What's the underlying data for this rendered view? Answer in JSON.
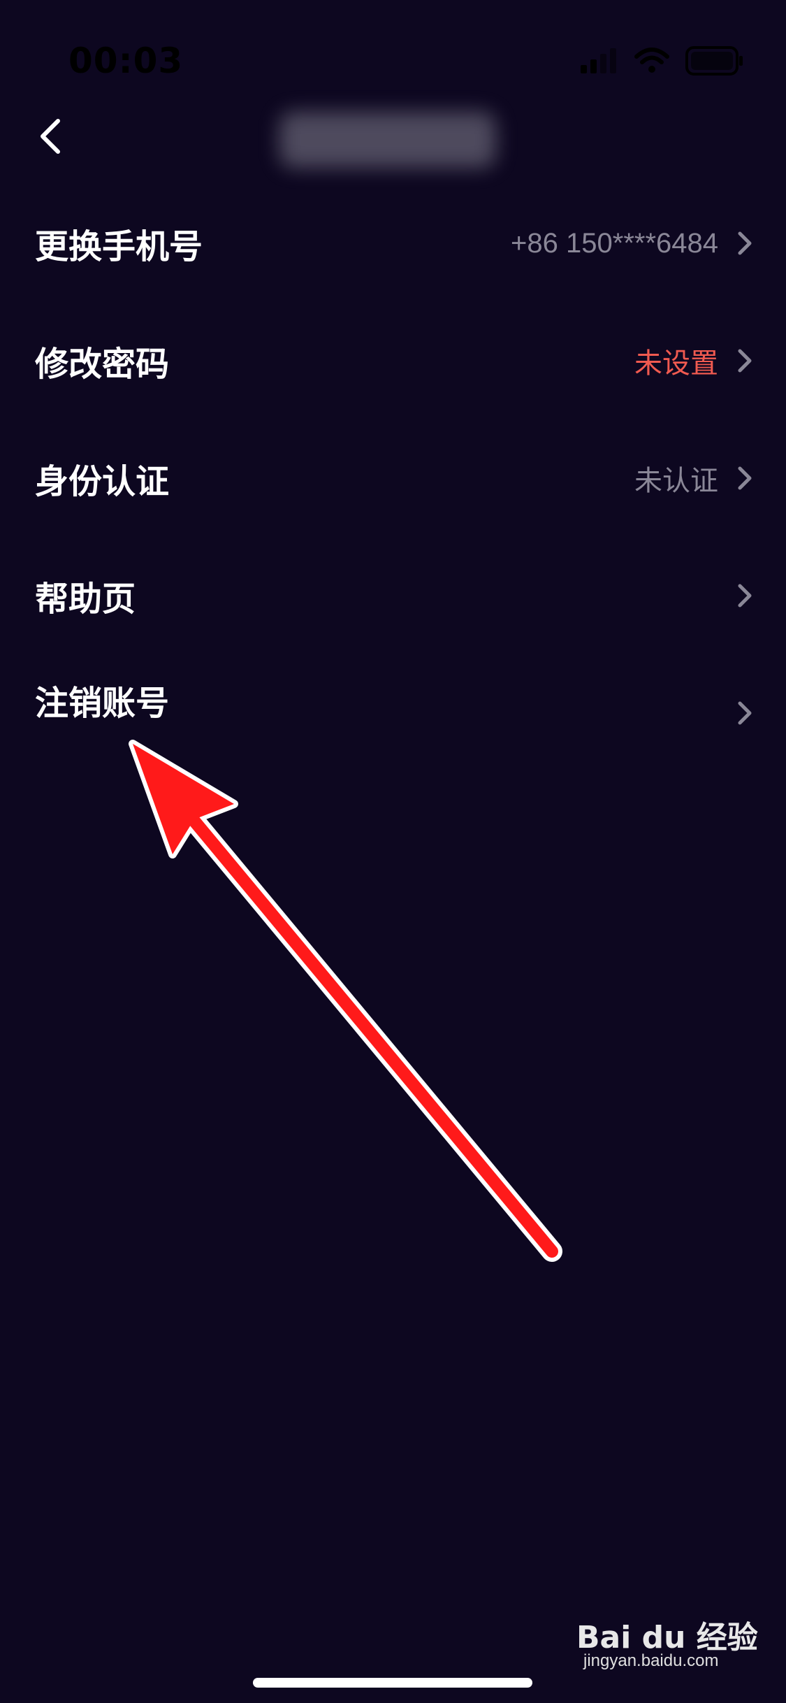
{
  "status_bar": {
    "time": "00:03",
    "icons": [
      "signal-icon",
      "wifi-icon",
      "battery-icon"
    ]
  },
  "nav": {
    "back_icon": "chevron-left-icon",
    "title_blurred": true
  },
  "settings": {
    "items": [
      {
        "label": "更换手机号",
        "value": "+86 150****6484",
        "value_color": "#8a8797"
      },
      {
        "label": "修改密码",
        "value": "未设置",
        "value_color": "#f05a50"
      },
      {
        "label": "身份认证",
        "value": "未认证",
        "value_color": "#8a8797"
      },
      {
        "label": "帮助页",
        "value": ""
      },
      {
        "label": "注销账号",
        "value": ""
      }
    ]
  },
  "annotation": {
    "type": "arrow",
    "color": "#ff1a1a",
    "points_to": "注销账号"
  },
  "watermark": {
    "logo": "Bai du 经验",
    "url": "jingyan.baidu.com"
  },
  "colors": {
    "background": "#0d0720",
    "label": "#ffffff",
    "muted": "#8a8797",
    "warning": "#f05a50"
  }
}
